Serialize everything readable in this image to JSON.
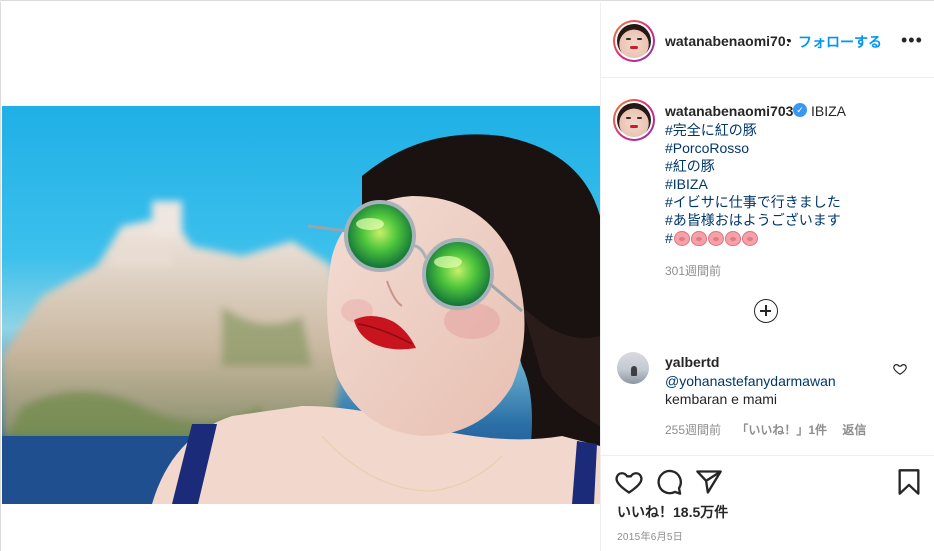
{
  "post": {
    "username": "watanabenaomi703",
    "username_truncated": "watanabenaomi70:",
    "follow_label": "フォローする",
    "separator": "•",
    "more_label": "•••"
  },
  "caption": {
    "username": "watanabenaomi703",
    "location": "IBIZA",
    "lines": [
      "#完全に紅の豚",
      "#PorcoRosso",
      "#紅の豚",
      "#IBIZA",
      "#イビサに仕事で行きました",
      "#あ皆様おはようございます"
    ],
    "last_line_hash": "#",
    "emoji_names": [
      "pig-face-icon",
      "pig-nose-icon",
      "pig-face-icon",
      "pig-nose-icon",
      "pig-face-icon"
    ],
    "time_ago": "301週間前"
  },
  "comment": {
    "username": "yalbertd",
    "mention": "@yohanastefanydarmawan",
    "text": "kembaran e mami",
    "time_ago": "255週間前",
    "likes_label": "「いいね！」1件",
    "reply_label": "返信"
  },
  "footer": {
    "likes": "いいね！18.5万件",
    "date": "2015年6月5日"
  },
  "colors": {
    "link_blue": "#0095f6",
    "hashtag": "#00376b",
    "muted": "#8e8e8e"
  }
}
